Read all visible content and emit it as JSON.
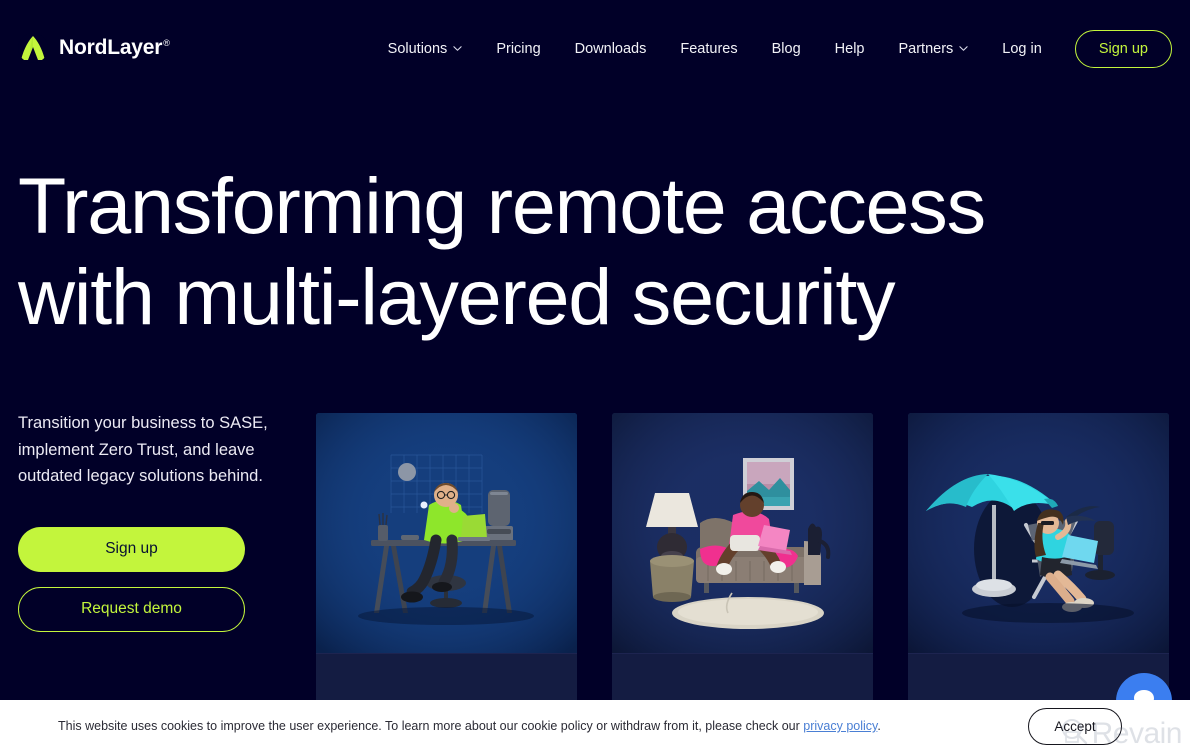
{
  "brand": {
    "name": "NordLayer",
    "trademark": "®",
    "logo_icon": "nordlayer-mountain-logo",
    "accent_color": "#c3f53c",
    "background_color": "#010028"
  },
  "nav": {
    "items": [
      {
        "label": "Solutions",
        "has_dropdown": true
      },
      {
        "label": "Pricing",
        "has_dropdown": false
      },
      {
        "label": "Downloads",
        "has_dropdown": false
      },
      {
        "label": "Features",
        "has_dropdown": false
      },
      {
        "label": "Blog",
        "has_dropdown": false
      },
      {
        "label": "Help",
        "has_dropdown": false
      },
      {
        "label": "Partners",
        "has_dropdown": true
      },
      {
        "label": "Log in",
        "has_dropdown": false
      }
    ],
    "signup_label": "Sign up"
  },
  "hero": {
    "headline_line1": "Transforming remote access",
    "headline_line2": "with multi-layered security",
    "subtext": "Transition your business to SASE, implement Zero Trust, and leave outdated legacy solutions behind.",
    "primary_cta": "Sign up",
    "secondary_cta": "Request demo"
  },
  "cards": [
    {
      "alt": "person-in-green-shirt-working-at-desk"
    },
    {
      "alt": "person-in-pink-shirt-on-sofa-with-laptop"
    },
    {
      "alt": "person-in-deck-chair-under-blue-umbrella-with-laptop"
    }
  ],
  "chat": {
    "icon": "chat-bubble-icon"
  },
  "cookie": {
    "text_before_link": "This website uses cookies to improve the user experience. To learn more about our cookie policy or withdraw from it, please check our ",
    "link_label": "privacy policy",
    "text_after_link": ".",
    "accept_label": "Accept"
  },
  "watermark": {
    "label": "Revain",
    "icon": "magnifier-icon"
  }
}
